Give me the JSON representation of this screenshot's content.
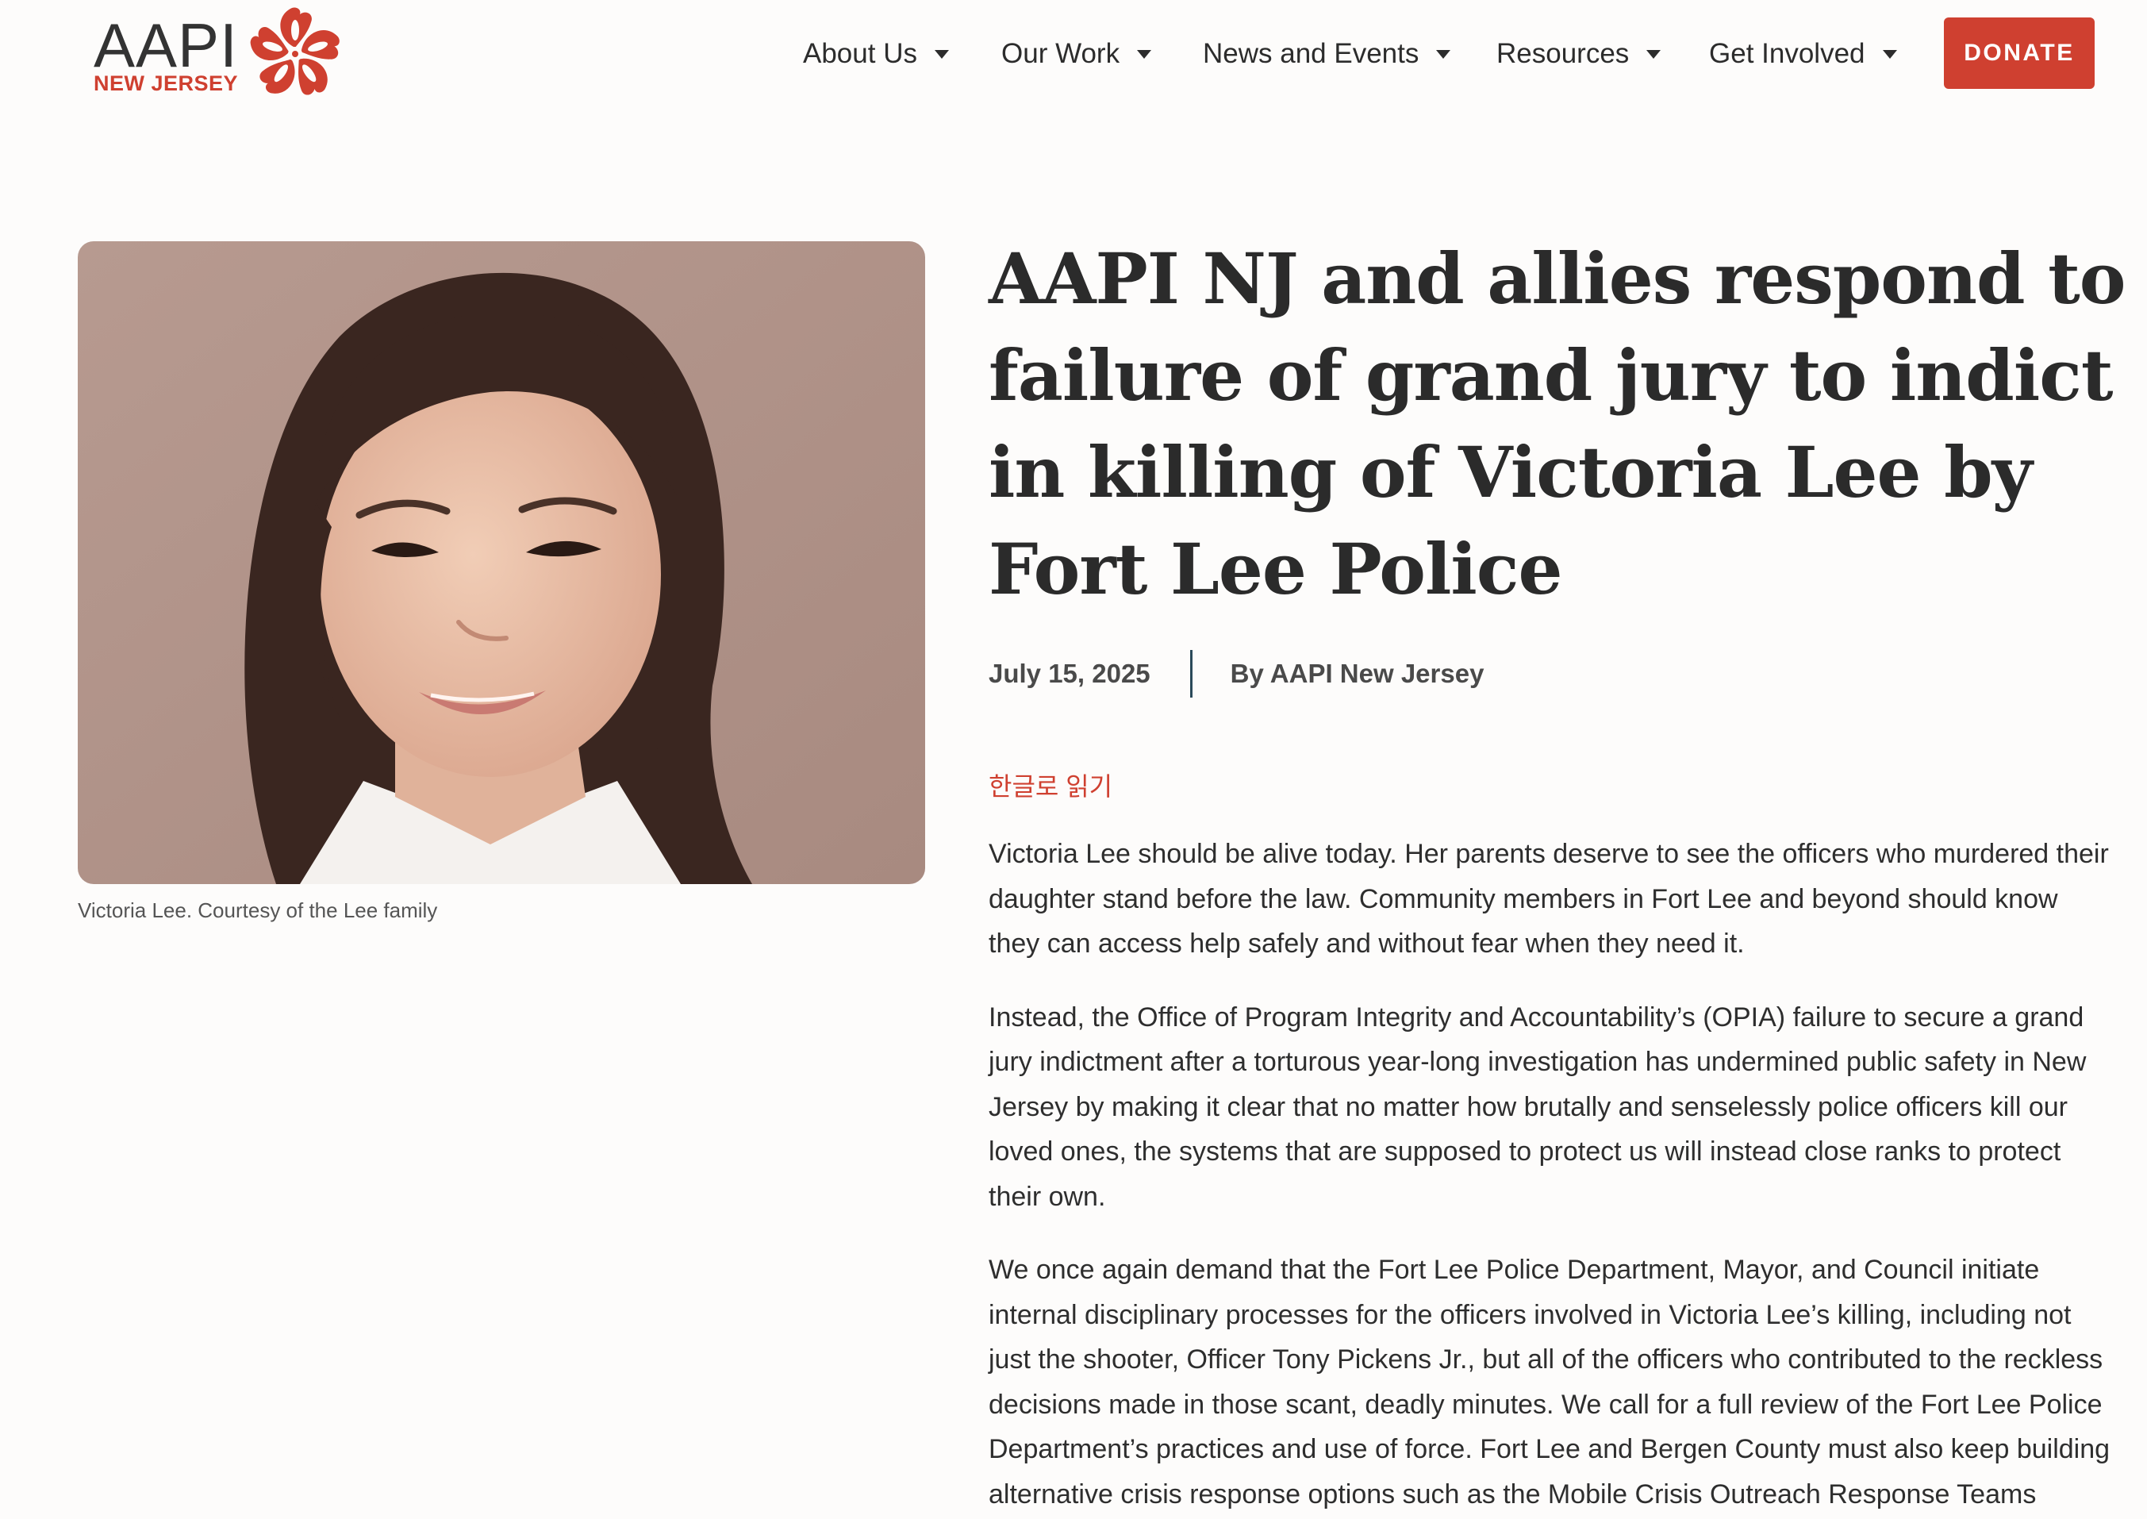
{
  "header": {
    "logo": {
      "main": "AAPI",
      "sub": "NEW JERSEY"
    },
    "nav": [
      {
        "label": "About Us"
      },
      {
        "label": "Our Work"
      },
      {
        "label": "News and Events"
      },
      {
        "label": "Resources"
      },
      {
        "label": "Get Involved"
      }
    ],
    "donate_label": "DONATE"
  },
  "colors": {
    "accent": "#cf4030",
    "text": "#333333",
    "background": "#fdfcfb"
  },
  "feature_image": {
    "icon": "portrait-photo",
    "caption": "Victoria Lee. Courtesy of the Lee family"
  },
  "article": {
    "title": "AAPI NJ and allies respond to failure of grand jury to indict in killing of Victoria Lee by Fort Lee Police",
    "date": "July 15, 2025",
    "author": "By AAPI New Jersey",
    "language_link": "한글로 읽기",
    "paragraphs": [
      "Victoria Lee should be alive today. Her parents deserve to see the officers who murdered their daughter stand before the law. Community members in Fort Lee and beyond should know they can access help safely and without fear when they need it.",
      "Instead, the Office of Program Integrity and Accountability’s (OPIA) failure to secure a grand jury indictment after a torturous year-long investigation has undermined public safety in New Jersey by making it clear that no matter how brutally and senselessly police officers kill our loved ones, the systems that are supposed to protect us will instead close ranks to protect their own.",
      "We once again demand that the Fort Lee Police Department, Mayor, and Council initiate internal disciplinary processes for the officers involved in Victoria Lee’s killing, including not just the shooter, Officer Tony Pickens Jr., but all of the officers who contributed to the reckless decisions made in those scant, deadly minutes. We call for a full review of the Fort Lee Police Department’s practices and use of force. Fort Lee and Bergen County must also keep building alternative crisis response options such as the Mobile Crisis Outreach Response Teams"
    ]
  }
}
